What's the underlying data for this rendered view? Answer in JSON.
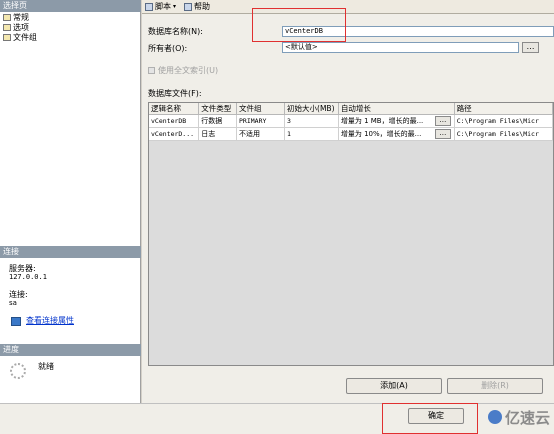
{
  "left_panel": {
    "select_page_header": "选择页",
    "pages": [
      {
        "label": "常规"
      },
      {
        "label": "选项"
      },
      {
        "label": "文件组"
      }
    ],
    "connection_header": "连接",
    "server_label": "服务器:",
    "server_value": "127.0.0.1",
    "connection_label": "连接:",
    "connection_value": "sa",
    "view_props_link": "查看连接属性",
    "progress_header": "进度",
    "progress_status": "就绪"
  },
  "toolbar": {
    "script_label": "脚本",
    "help_label": "帮助"
  },
  "form": {
    "db_name_label": "数据库名称(N):",
    "db_name_value": "vCenterDB",
    "owner_label": "所有者(O):",
    "owner_value": "<默认值>",
    "fulltext_label": "使用全文索引(U)",
    "db_files_label": "数据库文件(F):"
  },
  "grid": {
    "columns": [
      "逻辑名称",
      "文件类型",
      "文件组",
      "初始大小(MB)",
      "自动增长",
      "路径"
    ],
    "rows": [
      [
        "vCenterDB",
        "行数据",
        "PRIMARY",
        "3",
        "增量为 1 MB，增长的最...",
        "C:\\Program Files\\Micr"
      ],
      [
        "vCenterD...",
        "日志",
        "不适用",
        "1",
        "增量为 10%，增长的最...",
        "C:\\Program Files\\Micr"
      ]
    ]
  },
  "buttons": {
    "add": "添加(A)",
    "remove": "删除(R)",
    "ok": "确定"
  },
  "watermark": "亿速云"
}
